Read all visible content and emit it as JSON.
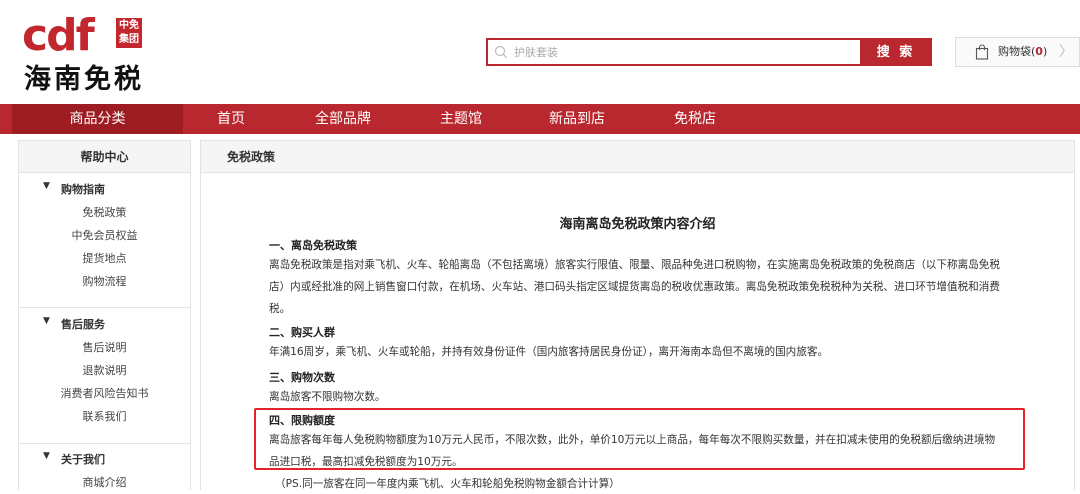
{
  "logo": {
    "brand": "cdf",
    "badge_line1": "中免",
    "badge_line2": "集团",
    "subtitle": "海南免税"
  },
  "search": {
    "placeholder": "护肤套装",
    "button": "搜 索"
  },
  "cart": {
    "label": "购物袋",
    "count_open": "(",
    "count": "0",
    "count_close": ")",
    "arrow": "〉"
  },
  "nav": {
    "category": "商品分类",
    "items": [
      "首页",
      "全部品牌",
      "主题馆",
      "新品到店",
      "免税店"
    ]
  },
  "sidebar": {
    "title": "帮助中心",
    "groups": [
      {
        "title": "购物指南",
        "links": [
          "免税政策",
          "中免会员权益",
          "提货地点",
          "购物流程"
        ]
      },
      {
        "title": "售后服务",
        "links": [
          "售后说明",
          "退款说明",
          "消费者风险告知书",
          "联系我们"
        ]
      },
      {
        "title": "关于我们",
        "links": [
          "商城介绍"
        ]
      }
    ]
  },
  "main": {
    "breadcrumb": "免税政策",
    "title": "海南离岛免税政策内容介绍",
    "sections": [
      {
        "heading": "一、离岛免税政策",
        "lines": [
          "离岛免税政策是指对乘飞机、火车、轮船离岛（不包括离境）旅客实行限值、限量、限品种免进口税购物，在实施离岛免税政策的免税商店（以下称离岛免税",
          "店）内或经批准的网上销售窗口付款，在机场、火车站、港口码头指定区域提货离岛的税收优惠政策。离岛免税政策免税税种为关税、进口环节增值税和消费",
          "税。"
        ]
      },
      {
        "heading": "二、购买人群",
        "lines": [
          "年满16周岁，乘飞机、火车或轮船，并持有效身份证件（国内旅客持居民身份证），离开海南本岛但不离境的国内旅客。"
        ]
      },
      {
        "heading": "三、购物次数",
        "lines": [
          "离岛旅客不限购物次数。"
        ]
      },
      {
        "heading": "四、限购额度",
        "lines": [
          "离岛旅客每年每人免税购物额度为10万元人民币，不限次数，此外，单价10万元以上商品，每年每次不限购买数量，并在扣减未使用的免税额后缴纳进境物",
          "品进口税，最高扣减免税额度为10万元。"
        ]
      }
    ],
    "note": "（PS.同一旅客在同一年度内乘飞机、火车和轮船免税购物金额合计计算）"
  },
  "colors": {
    "brand_red": "#b8282e",
    "highlight_border": "#e0262b"
  },
  "icons": [
    "search-icon",
    "cart-icon",
    "caret-down-icon",
    "chevron-right-icon"
  ]
}
